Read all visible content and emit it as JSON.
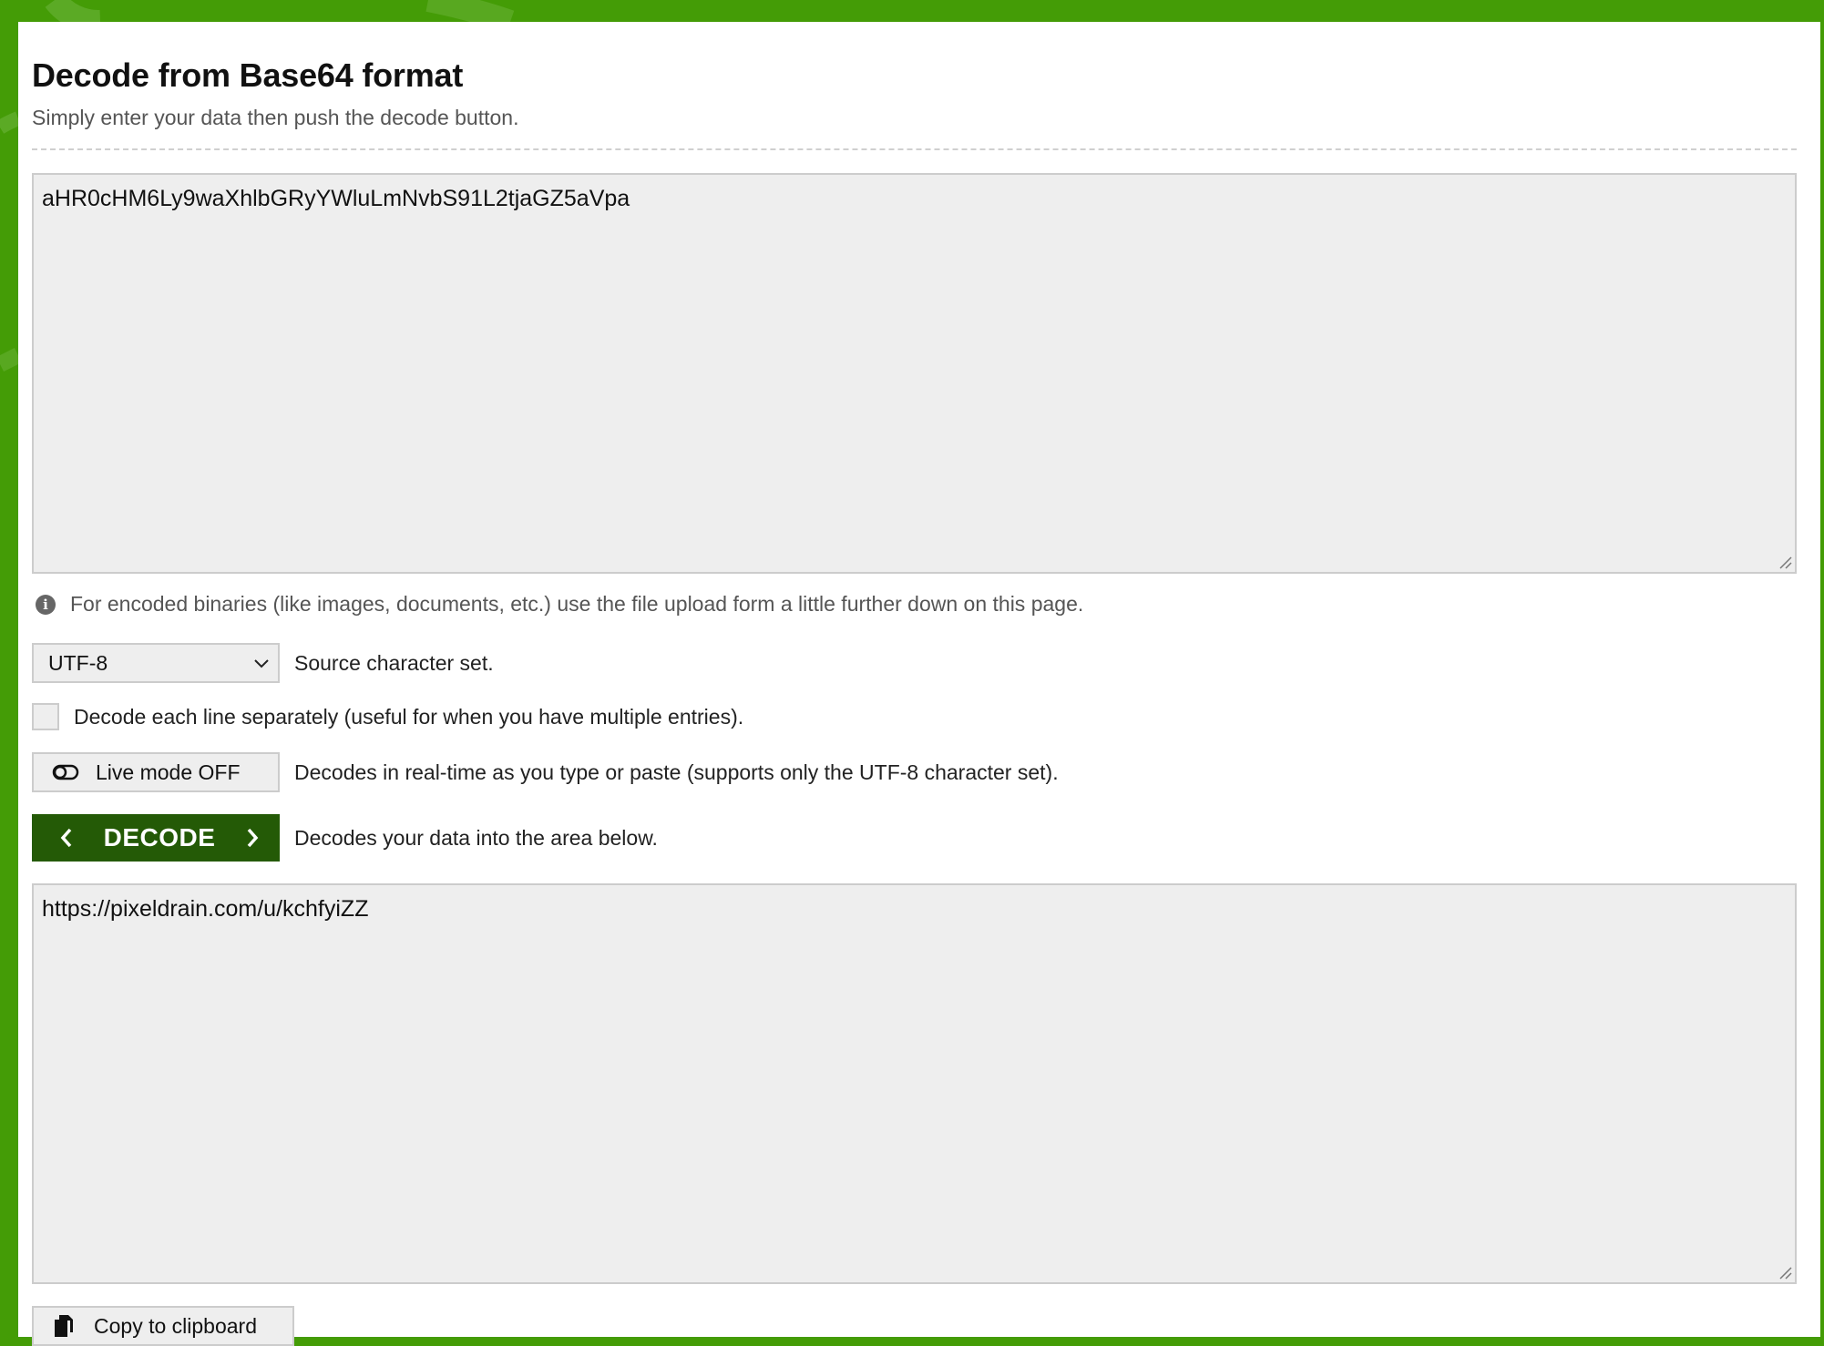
{
  "header": {
    "title": "Decode from Base64 format",
    "subtitle": "Simply enter your data then push the decode button."
  },
  "input": {
    "value": "aHR0cHM6Ly9waXhlbGRyYWluLmNvbS91L2tjaGZ5aVpa"
  },
  "info": {
    "icon": "info-icon",
    "text": "For encoded binaries (like images, documents, etc.) use the file upload form a little further down on this page."
  },
  "charset": {
    "selected": "UTF-8",
    "label": "Source character set."
  },
  "line_separate": {
    "checked": false,
    "label": "Decode each line separately (useful for when you have multiple entries)."
  },
  "live_mode": {
    "button_label": "Live mode OFF",
    "description": "Decodes in real-time as you type or paste (supports only the UTF-8 character set)."
  },
  "decode": {
    "button_label": "DECODE",
    "description": "Decodes your data into the area below."
  },
  "output": {
    "value": "https://pixeldrain.com/u/kchfyiZZ"
  },
  "copy": {
    "button_label": "Copy to clipboard"
  },
  "colors": {
    "background_green": "#449c06",
    "decode_button": "#245a06",
    "field_bg": "#eeeeee",
    "field_border": "#cccccc"
  }
}
